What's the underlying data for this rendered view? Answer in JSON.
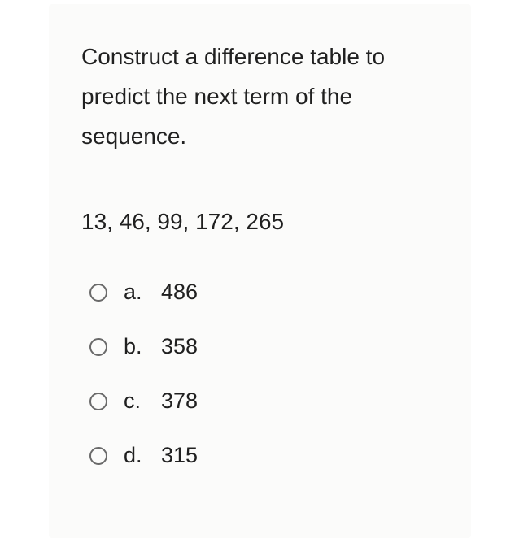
{
  "question": "Construct a difference table to predict the next term of the sequence.",
  "sequence": "13, 46, 99, 172, 265",
  "options": [
    {
      "letter": "a.",
      "value": "486"
    },
    {
      "letter": "b.",
      "value": "358"
    },
    {
      "letter": "c.",
      "value": "378"
    },
    {
      "letter": "d.",
      "value": "315"
    }
  ]
}
